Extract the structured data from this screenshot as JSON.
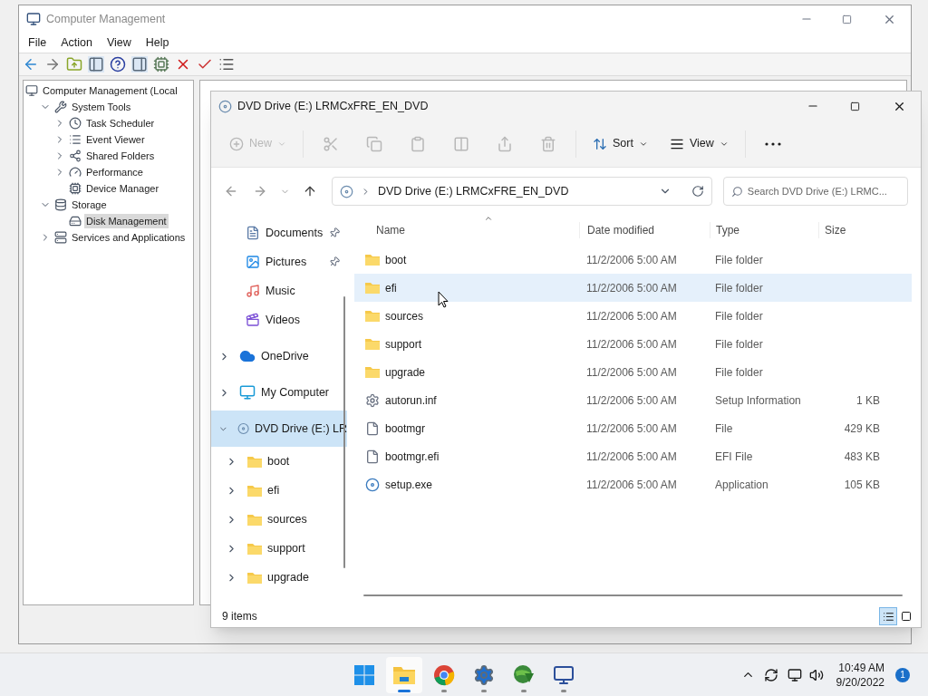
{
  "computer_management": {
    "title": "Computer Management",
    "menu": [
      "File",
      "Action",
      "View",
      "Help"
    ],
    "tree": [
      {
        "label": "Computer Management (Local",
        "kind": "root",
        "selected": false,
        "children": [
          {
            "label": "System Tools",
            "kind": "branch",
            "expanded": true,
            "selected": false,
            "children": [
              {
                "label": "Task Scheduler",
                "kind": "branch",
                "expanded": false,
                "selected": false
              },
              {
                "label": "Event Viewer",
                "kind": "branch",
                "expanded": false,
                "selected": false
              },
              {
                "label": "Shared Folders",
                "kind": "branch",
                "expanded": false,
                "selected": false
              },
              {
                "label": "Performance",
                "kind": "branch",
                "expanded": false,
                "selected": false
              },
              {
                "label": "Device Manager",
                "kind": "leaf",
                "selected": false
              }
            ]
          },
          {
            "label": "Storage",
            "kind": "branch",
            "expanded": true,
            "selected": false,
            "children": [
              {
                "label": "Disk Management",
                "kind": "leaf",
                "selected": true
              }
            ]
          },
          {
            "label": "Services and Applications",
            "kind": "branch",
            "expanded": false,
            "selected": false
          }
        ]
      }
    ]
  },
  "explorer": {
    "title": "DVD Drive (E:) LRMCxFRE_EN_DVD",
    "commands": [
      {
        "kind": "new",
        "label": "New",
        "disabled": true
      },
      {
        "kind": "cut",
        "disabled": true
      },
      {
        "kind": "copy",
        "disabled": true
      },
      {
        "kind": "paste",
        "disabled": true
      },
      {
        "kind": "rename",
        "disabled": true
      },
      {
        "kind": "share",
        "disabled": true
      },
      {
        "kind": "delete",
        "disabled": true
      },
      {
        "kind": "sort",
        "label": "Sort",
        "disabled": false
      },
      {
        "kind": "view",
        "label": "View",
        "disabled": false
      },
      {
        "kind": "more",
        "disabled": false
      }
    ],
    "address": "DVD Drive (E:) LRMCxFRE_EN_DVD",
    "search": {
      "placeholder": "Search DVD Drive (E:) LRMC..."
    },
    "quick_access": [
      {
        "label": "Documents",
        "pinned": true
      },
      {
        "label": "Pictures",
        "pinned": true
      },
      {
        "label": "Music",
        "pinned": false
      },
      {
        "label": "Videos",
        "pinned": false
      }
    ],
    "nav_tree": [
      {
        "label": "OneDrive",
        "kind": "cloud",
        "expanded": false,
        "selected": false
      },
      {
        "label": "My Computer",
        "kind": "computer",
        "expanded": false,
        "selected": false
      },
      {
        "label": "DVD Drive (E:) LR",
        "kind": "drive",
        "expanded": true,
        "selected": true,
        "children": [
          {
            "label": "boot",
            "kind": "folder",
            "expanded": false,
            "selected": false
          },
          {
            "label": "efi",
            "kind": "folder",
            "expanded": false,
            "selected": false
          },
          {
            "label": "sources",
            "kind": "folder",
            "expanded": false,
            "selected": false
          },
          {
            "label": "support",
            "kind": "folder",
            "expanded": false,
            "selected": false
          },
          {
            "label": "upgrade",
            "kind": "folder",
            "expanded": false,
            "selected": false
          }
        ]
      }
    ],
    "columns": [
      "Name",
      "Date modified",
      "Type",
      "Size"
    ],
    "files": [
      {
        "name": "boot",
        "kind": "folder",
        "date": "11/2/2006 5:00 AM",
        "type": "File folder",
        "selected": false
      },
      {
        "name": "efi",
        "kind": "folder",
        "date": "11/2/2006 5:00 AM",
        "type": "File folder",
        "selected": true
      },
      {
        "name": "sources",
        "kind": "folder",
        "date": "11/2/2006 5:00 AM",
        "type": "File folder",
        "selected": false
      },
      {
        "name": "support",
        "kind": "folder",
        "date": "11/2/2006 5:00 AM",
        "type": "File folder",
        "selected": false
      },
      {
        "name": "upgrade",
        "kind": "folder",
        "date": "11/2/2006 5:00 AM",
        "type": "File folder",
        "selected": false
      },
      {
        "name": "autorun.inf",
        "kind": "setup",
        "date": "11/2/2006 5:00 AM",
        "type": "Setup Information",
        "size": "1 KB",
        "selected": false
      },
      {
        "name": "bootmgr",
        "kind": "file",
        "date": "11/2/2006 5:00 AM",
        "type": "File",
        "size": "429 KB",
        "selected": false
      },
      {
        "name": "bootmgr.efi",
        "kind": "file",
        "date": "11/2/2006 5:00 AM",
        "type": "EFI File",
        "size": "483 KB",
        "selected": false
      },
      {
        "name": "setup.exe",
        "kind": "app",
        "date": "11/2/2006 5:00 AM",
        "type": "Application",
        "size": "105 KB",
        "selected": false
      }
    ],
    "status": "9 items",
    "view_modes": [
      {
        "kind": "details",
        "selected": true
      },
      {
        "kind": "tiles",
        "selected": false
      }
    ]
  },
  "taskbar": {
    "apps": [
      {
        "kind": "start",
        "active": false
      },
      {
        "kind": "explorer",
        "active": true
      },
      {
        "kind": "chrome",
        "active": false
      },
      {
        "kind": "settings",
        "active": false
      },
      {
        "kind": "download",
        "active": false
      },
      {
        "kind": "remote",
        "active": false
      }
    ],
    "time": "10:49 AM",
    "date": "9/20/2022",
    "notifications": "1"
  }
}
